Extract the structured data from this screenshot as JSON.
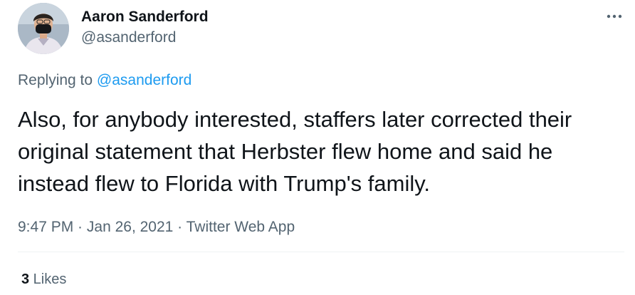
{
  "author": {
    "display_name": "Aaron Sanderford",
    "handle": "@asanderford",
    "avatar_icon": "profile-photo"
  },
  "more_icon": "more-horizontal-icon",
  "reply_context": {
    "prefix": "Replying to ",
    "mention": "@asanderford"
  },
  "tweet": {
    "text": "Also, for anybody interested, staffers later corrected their original statement that Herbster flew home and said he instead flew to Florida with Trump's family."
  },
  "meta": {
    "time": "9:47 PM",
    "separator": " · ",
    "date": "Jan 26, 2021",
    "source": "Twitter Web App"
  },
  "stats": {
    "likes_count": "3",
    "likes_label": " Likes"
  },
  "colors": {
    "accent": "#1d9bf0",
    "secondary_text": "#536471",
    "primary_text": "#0f1419",
    "divider": "#eff3f4"
  }
}
